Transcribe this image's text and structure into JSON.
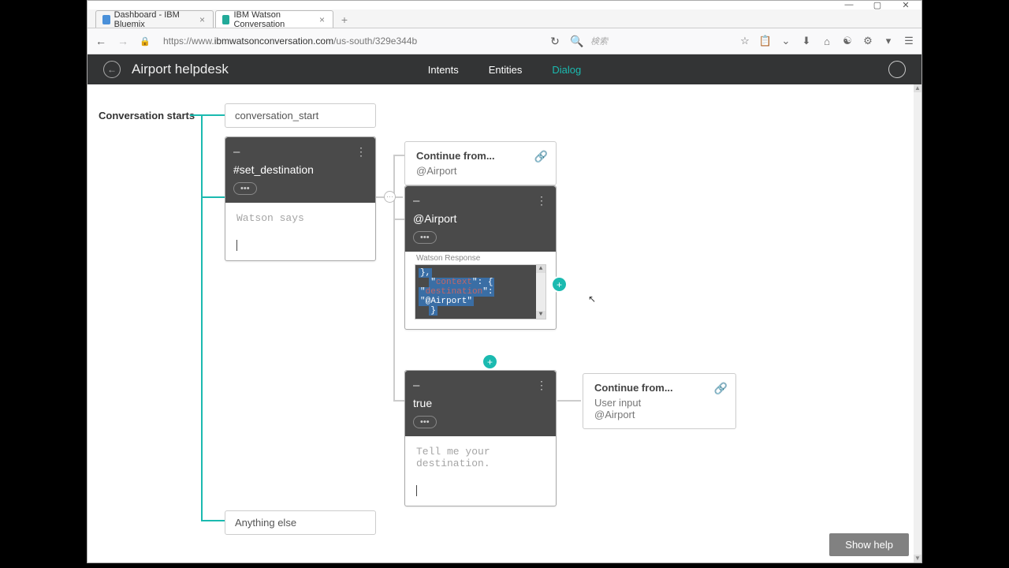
{
  "window": {
    "minimize": "—",
    "maximize": "▢",
    "close": "✕"
  },
  "browser": {
    "tabs": [
      {
        "label": "Dashboard - IBM Bluemix",
        "active": false
      },
      {
        "label": "IBM Watson Conversation",
        "active": true
      }
    ],
    "url_prefix": "https://www.",
    "url_domain": "ibmwatsonconversation.com",
    "url_path": "/us-south/329e344b",
    "search_placeholder": "検索"
  },
  "header": {
    "title": "Airport helpdesk",
    "tabs": {
      "intents": "Intents",
      "entities": "Entities",
      "dialog": "Dialog"
    }
  },
  "canvas": {
    "conversation_label": "Conversation starts",
    "conv_start_node": "conversation_start",
    "anything_else": "Anything else",
    "set_dest": {
      "title": "#set_destination",
      "placeholder": "Watson says"
    },
    "continue1": {
      "title": "Continue from...",
      "sub": "@Airport"
    },
    "airport_node": {
      "title": "@Airport",
      "resp_label": "Watson Response",
      "json_lines": {
        "l1": "},",
        "l2a": "\"",
        "l2b": "context",
        "l2c": "\": {",
        "l3a": "\"",
        "l3b": "destination",
        "l3c": "\":",
        "l4": "\"@Airport\"",
        "l5": "}"
      }
    },
    "true_node": {
      "title": "true",
      "response": "Tell me your destination."
    },
    "continue2": {
      "title": "Continue from...",
      "sub1": "User input",
      "sub2": "@Airport"
    },
    "show_help": "Show help"
  }
}
